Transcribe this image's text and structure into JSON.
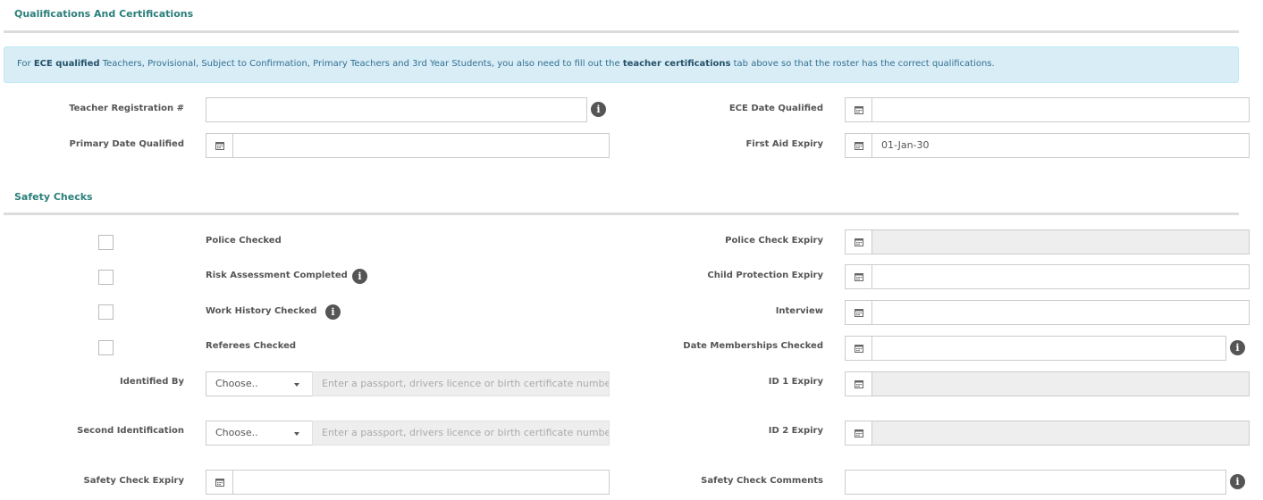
{
  "sections": {
    "qualifications_title": "Qualifications And Certifications",
    "safety_title": "Safety Checks"
  },
  "notice": {
    "prefix": "For ",
    "bold1": "ECE qualified",
    "middle": " Teachers, Provisional, Subject to Confirmation, Primary Teachers and 3rd Year Students, you also need to fill out the ",
    "bold2": "teacher certifications",
    "suffix": " tab above so that the roster has the correct qualifications."
  },
  "qualifications": {
    "teacher_registration_label": "Teacher Registration #",
    "teacher_registration_value": "",
    "ece_date_label": "ECE Date Qualified",
    "ece_date_value": "",
    "primary_date_label": "Primary Date Qualified",
    "primary_date_value": "",
    "first_aid_label": "First Aid Expiry",
    "first_aid_value": "01-Jan-30"
  },
  "safety": {
    "police_checked_label": "Police Checked",
    "risk_assessment_label": "Risk Assessment Completed",
    "work_history_label": "Work History Checked",
    "referees_label": "Referees Checked",
    "police_expiry_label": "Police Check Expiry",
    "child_protection_label": "Child Protection Expiry",
    "interview_label": "Interview",
    "memberships_label": "Date Memberships Checked",
    "identified_by_label": "Identified By",
    "second_id_label": "Second Identification",
    "choose": "Choose..",
    "id_placeholder": "Enter a passport, drivers licence or birth certificate number",
    "id1_expiry_label": "ID 1 Expiry",
    "id2_expiry_label": "ID 2 Expiry",
    "safety_expiry_label": "Safety Check Expiry",
    "safety_comments_label": "Safety Check Comments"
  },
  "icons": {
    "info": "info-icon",
    "calendar": "calendar-icon",
    "caret": "caret-down-icon"
  },
  "colors": {
    "section_title": "#2a7f7a",
    "notice_bg": "#d9edf7",
    "notice_text": "#31708f",
    "disabled_bg": "#eeeeee"
  }
}
